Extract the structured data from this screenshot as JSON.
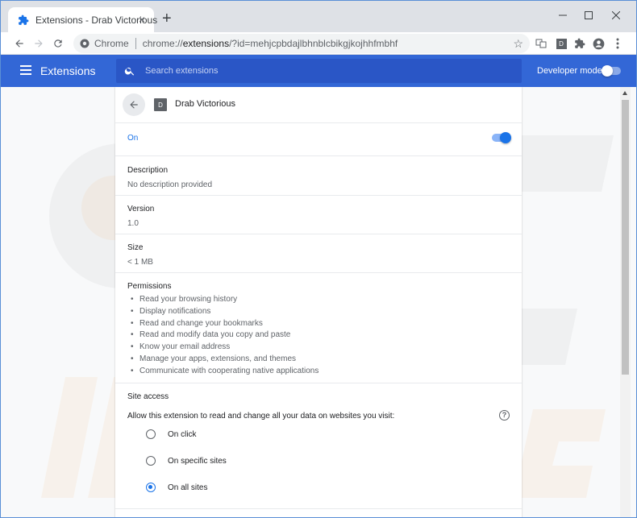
{
  "window": {
    "tab_title": "Extensions - Drab Victorious",
    "tab_close": "×",
    "new_tab": "+"
  },
  "toolbar": {
    "site_label": "Chrome",
    "url_host": "chrome://",
    "url_path": "extensions",
    "url_query": "/?id=mehjcpbdajlbhnblcbikgjkojhhfmbhf",
    "profile_ext_letter": "D"
  },
  "header": {
    "title": "Extensions",
    "search_placeholder": "Search extensions",
    "developer_mode_label": "Developer mode",
    "developer_mode_on": false
  },
  "detail": {
    "icon_letter": "D",
    "name": "Drab Victorious",
    "status_label": "On",
    "enabled": true,
    "description_label": "Description",
    "description_value": "No description provided",
    "version_label": "Version",
    "version_value": "1.0",
    "size_label": "Size",
    "size_value": "< 1 MB",
    "permissions_label": "Permissions",
    "permissions": [
      "Read your browsing history",
      "Display notifications",
      "Read and change your bookmarks",
      "Read and modify data you copy and paste",
      "Know your email address",
      "Manage your apps, extensions, and themes",
      "Communicate with cooperating native applications"
    ],
    "site_access_label": "Site access",
    "site_access_description": "Allow this extension to read and change all your data on websites you visit:",
    "site_access_help": "?",
    "site_access_options": [
      {
        "label": "On click",
        "selected": false
      },
      {
        "label": "On specific sites",
        "selected": false
      },
      {
        "label": "On all sites",
        "selected": true
      }
    ]
  },
  "colors": {
    "header_blue": "#3367d6",
    "accent_blue": "#1a73e8"
  }
}
